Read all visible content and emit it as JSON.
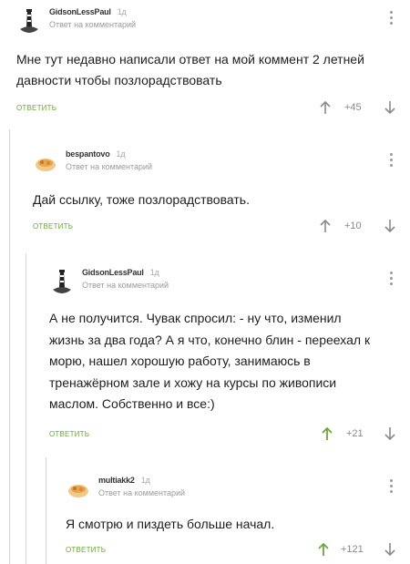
{
  "labels": {
    "reply_to_comment": "Ответ на комментарий",
    "reply_button": "ОТВЕТИТЬ"
  },
  "colors": {
    "accent_green": "#6aa639",
    "muted": "#9b9b9b",
    "branch_line": "#d6d6d6"
  },
  "comments": [
    {
      "author": "GidsonLessPaul",
      "age": "1д",
      "text": "Мне тут недавно написали ответ на мой коммент 2 летней давности чтобы позлорадствовать",
      "rating": "+45",
      "upvote_icon": "arrow-up-icon",
      "downvote_icon": "arrow-down-icon",
      "upvote_active": false
    },
    {
      "author": "bespantovo",
      "age": "1д",
      "text": "Дай ссылку, тоже позлорадствовать.",
      "rating": "+10",
      "upvote_icon": "arrow-up-icon",
      "downvote_icon": "arrow-down-icon",
      "upvote_active": false
    },
    {
      "author": "GidsonLessPaul",
      "age": "1д",
      "text": "А не получится. Чувак спросил: - ну что, изменил жизнь за два года? А я что, конечно блин - переехал к морю, нашел хорошую работу, занимаюсь в тренажёрном зале и хожу на курсы по живописи маслом. Собственно и все:)",
      "rating": "+21",
      "upvote_icon": "arrow-up-icon",
      "downvote_icon": "arrow-down-icon",
      "upvote_active": true
    },
    {
      "author": "multiakk2",
      "age": "1д",
      "text": "Я смотрю и пиздеть больше начал.",
      "rating": "+121",
      "upvote_icon": "arrow-up-icon",
      "downvote_icon": "arrow-down-icon",
      "upvote_active": true
    }
  ]
}
